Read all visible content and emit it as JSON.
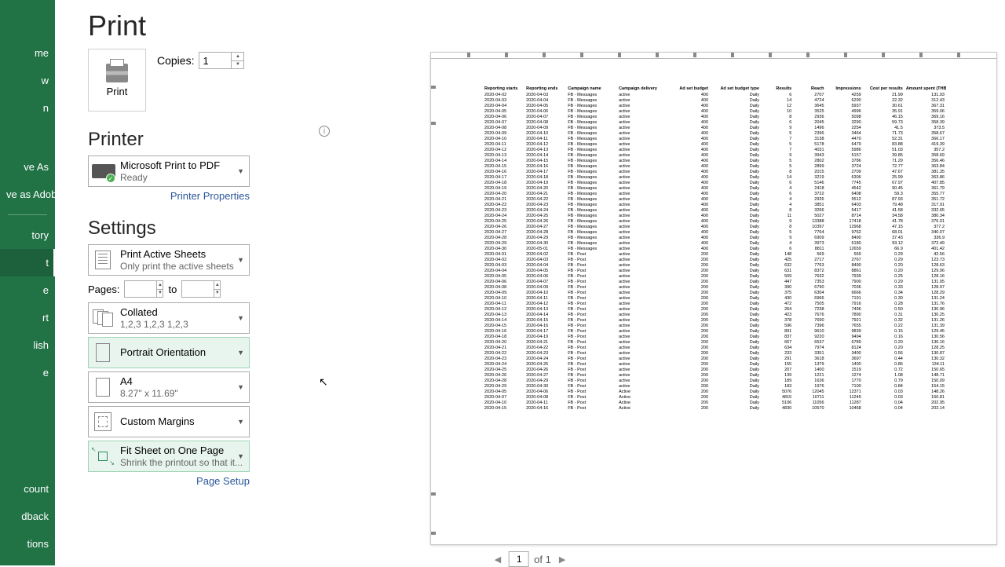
{
  "title": "Print",
  "sidebar": {
    "items": [
      "me",
      "w",
      "n",
      "",
      "",
      "ve As",
      "ve as Adobe F",
      "tory",
      "t",
      "e",
      "rt",
      "lish",
      "e"
    ],
    "bottom": [
      "count",
      "dback",
      "tions"
    ],
    "active_index": 8
  },
  "print_button_label": "Print",
  "copies": {
    "label": "Copies:",
    "value": "1"
  },
  "printer": {
    "heading": "Printer",
    "name": "Microsoft Print to PDF",
    "status": "Ready",
    "properties_link": "Printer Properties"
  },
  "settings": {
    "heading": "Settings",
    "scope": {
      "title": "Print Active Sheets",
      "sub": "Only print the active sheets"
    },
    "pages": {
      "label": "Pages:",
      "to": "to"
    },
    "collate": {
      "title": "Collated",
      "sub": "1,2,3    1,2,3    1,2,3"
    },
    "orientation": {
      "title": "Portrait Orientation"
    },
    "paper": {
      "title": "A4",
      "sub": "8.27\" x 11.69\""
    },
    "margins": {
      "title": "Custom Margins"
    },
    "scaling": {
      "title": "Fit Sheet on One Page",
      "sub": "Shrink the printout so that it..."
    },
    "page_setup_link": "Page Setup"
  },
  "pager": {
    "page": "1",
    "of": "of 1"
  },
  "preview": {
    "headers": [
      "Reporting starts",
      "Reporting ends",
      "Campaign name",
      "Campaign delivery",
      "Ad set budget",
      "Ad set budget type",
      "Results",
      "Reach",
      "Impressions",
      "Cost per results",
      "Amount spent (THB)"
    ],
    "rows": [
      [
        "2020-04-02",
        "2020-04-03",
        "FB - Messages",
        "active",
        "400",
        "Daily",
        "6",
        "2707",
        "4259",
        "21.99",
        "131.93"
      ],
      [
        "2020-04-03",
        "2020-04-04",
        "FB - Messages",
        "active",
        "400",
        "Daily",
        "14",
        "4724",
        "6290",
        "22.32",
        "312.43"
      ],
      [
        "2020-04-04",
        "2020-04-05",
        "FB - Messages",
        "active",
        "400",
        "Daily",
        "12",
        "3645",
        "5937",
        "30.61",
        "367.31"
      ],
      [
        "2020-04-05",
        "2020-04-06",
        "FB - Messages",
        "active",
        "400",
        "Daily",
        "10",
        "3525",
        "4996",
        "35.91",
        "359.06"
      ],
      [
        "2020-04-06",
        "2020-04-07",
        "FB - Messages",
        "active",
        "400",
        "Daily",
        "8",
        "2936",
        "5098",
        "46.15",
        "369.16"
      ],
      [
        "2020-04-07",
        "2020-04-08",
        "FB - Messages",
        "active",
        "400",
        "Daily",
        "6",
        "2045",
        "3290",
        "59.73",
        "358.39"
      ],
      [
        "2020-04-08",
        "2020-04-09",
        "FB - Messages",
        "active",
        "400",
        "Daily",
        "9",
        "1496",
        "2254",
        "41.5",
        "373.5"
      ],
      [
        "2020-04-09",
        "2020-04-10",
        "FB - Messages",
        "active",
        "400",
        "Daily",
        "5",
        "2396",
        "3464",
        "71.73",
        "358.67"
      ],
      [
        "2020-04-10",
        "2020-04-11",
        "FB - Messages",
        "active",
        "400",
        "Daily",
        "7",
        "3138",
        "4470",
        "52.31",
        "366.17"
      ],
      [
        "2020-04-11",
        "2020-04-12",
        "FB - Messages",
        "active",
        "400",
        "Daily",
        "5",
        "5178",
        "6479",
        "83.88",
        "419.39"
      ],
      [
        "2020-04-12",
        "2020-04-13",
        "FB - Messages",
        "active",
        "400",
        "Daily",
        "7",
        "4031",
        "5986",
        "51.03",
        "357.2"
      ],
      [
        "2020-04-13",
        "2020-04-14",
        "FB - Messages",
        "active",
        "400",
        "Daily",
        "9",
        "3943",
        "5157",
        "39.85",
        "358.69"
      ],
      [
        "2020-04-14",
        "2020-04-15",
        "FB - Messages",
        "active",
        "400",
        "Daily",
        "5",
        "2802",
        "3786",
        "71.29",
        "356.46"
      ],
      [
        "2020-04-15",
        "2020-04-16",
        "FB - Messages",
        "active",
        "400",
        "Daily",
        "5",
        "2899",
        "3724",
        "72.77",
        "363.84"
      ],
      [
        "2020-04-16",
        "2020-04-17",
        "FB - Messages",
        "active",
        "400",
        "Daily",
        "8",
        "2015",
        "2709",
        "47.67",
        "381.35"
      ],
      [
        "2020-04-17",
        "2020-04-18",
        "FB - Messages",
        "active",
        "400",
        "Daily",
        "14",
        "3219",
        "6306",
        "25.99",
        "363.86"
      ],
      [
        "2020-04-18",
        "2020-04-19",
        "FB - Messages",
        "active",
        "400",
        "Daily",
        "6",
        "5146",
        "7745",
        "67.97",
        "407.85"
      ],
      [
        "2020-04-19",
        "2020-04-20",
        "FB - Messages",
        "active",
        "400",
        "Daily",
        "4",
        "2418",
        "4542",
        "90.45",
        "361.79"
      ],
      [
        "2020-04-20",
        "2020-04-21",
        "FB - Messages",
        "active",
        "400",
        "Daily",
        "6",
        "3722",
        "6408",
        "59.3",
        "355.77"
      ],
      [
        "2020-04-21",
        "2020-04-22",
        "FB - Messages",
        "active",
        "400",
        "Daily",
        "4",
        "2926",
        "5512",
        "87.93",
        "351.72"
      ],
      [
        "2020-04-22",
        "2020-04-23",
        "FB - Messages",
        "active",
        "400",
        "Daily",
        "4",
        "3851",
        "6403",
        "79.48",
        "317.91"
      ],
      [
        "2020-04-23",
        "2020-04-24",
        "FB - Messages",
        "active",
        "400",
        "Daily",
        "8",
        "3266",
        "5417",
        "41.58",
        "332.65"
      ],
      [
        "2020-04-24",
        "2020-04-25",
        "FB - Messages",
        "active",
        "400",
        "Daily",
        "11",
        "5027",
        "8714",
        "34.58",
        "380.34"
      ],
      [
        "2020-04-25",
        "2020-04-26",
        "FB - Messages",
        "active",
        "400",
        "Daily",
        "9",
        "13388",
        "17418",
        "41.78",
        "376.01"
      ],
      [
        "2020-04-26",
        "2020-04-27",
        "FB - Messages",
        "active",
        "400",
        "Daily",
        "8",
        "10397",
        "12968",
        "47.15",
        "377.2"
      ],
      [
        "2020-04-27",
        "2020-04-28",
        "FB - Messages",
        "active",
        "400",
        "Daily",
        "5",
        "7764",
        "9762",
        "68.01",
        "340.07"
      ],
      [
        "2020-04-28",
        "2020-04-29",
        "FB - Messages",
        "active",
        "400",
        "Daily",
        "9",
        "6909",
        "8490",
        "37.43",
        "336.9"
      ],
      [
        "2020-04-29",
        "2020-04-30",
        "FB - Messages",
        "active",
        "400",
        "Daily",
        "4",
        "3973",
        "5180",
        "93.12",
        "372.49"
      ],
      [
        "2020-04-30",
        "2020-05-01",
        "FB - Messages",
        "active",
        "400",
        "Daily",
        "6",
        "8811",
        "12659",
        "66.9",
        "401.42"
      ],
      [
        "2020-04-01",
        "2020-04-02",
        "FB - Post",
        "active",
        "200",
        "Daily",
        "148",
        "569",
        "569",
        "0.29",
        "42.56"
      ],
      [
        "2020-04-02",
        "2020-04-03",
        "FB - Post",
        "active",
        "200",
        "Daily",
        "425",
        "2717",
        "2767",
        "0.29",
        "123.73"
      ],
      [
        "2020-04-03",
        "2020-04-04",
        "FB - Post",
        "active",
        "200",
        "Daily",
        "632",
        "7763",
        "8490",
        "0.20",
        "128.63"
      ],
      [
        "2020-04-04",
        "2020-04-05",
        "FB - Post",
        "active",
        "200",
        "Daily",
        "631",
        "8372",
        "8861",
        "0.20",
        "129.06"
      ],
      [
        "2020-04-05",
        "2020-04-06",
        "FB - Post",
        "active",
        "200",
        "Daily",
        "509",
        "7632",
        "7939",
        "0.25",
        "128.16"
      ],
      [
        "2020-04-06",
        "2020-04-07",
        "FB - Post",
        "active",
        "200",
        "Daily",
        "447",
        "7353",
        "7900",
        "0.29",
        "131.95"
      ],
      [
        "2020-04-08",
        "2020-04-09",
        "FB - Post",
        "active",
        "200",
        "Daily",
        "390",
        "6790",
        "7036",
        "0.33",
        "128.97"
      ],
      [
        "2020-04-09",
        "2020-04-10",
        "FB - Post",
        "active",
        "200",
        "Daily",
        "375",
        "6304",
        "6666",
        "0.34",
        "128.29"
      ],
      [
        "2020-04-10",
        "2020-04-11",
        "FB - Post",
        "active",
        "200",
        "Daily",
        "430",
        "6966",
        "7191",
        "0.30",
        "131.24"
      ],
      [
        "2020-04-11",
        "2020-04-12",
        "FB - Post",
        "active",
        "200",
        "Daily",
        "472",
        "7505",
        "7916",
        "0.28",
        "131.76"
      ],
      [
        "2020-04-12",
        "2020-04-13",
        "FB - Post",
        "active",
        "200",
        "Daily",
        "264",
        "7238",
        "7496",
        "0.50",
        "130.96"
      ],
      [
        "2020-04-13",
        "2020-04-14",
        "FB - Post",
        "active",
        "200",
        "Daily",
        "423",
        "7676",
        "7890",
        "0.31",
        "130.25"
      ],
      [
        "2020-04-14",
        "2020-04-15",
        "FB - Post",
        "active",
        "200",
        "Daily",
        "378",
        "7690",
        "7921",
        "0.32",
        "131.26"
      ],
      [
        "2020-04-15",
        "2020-04-16",
        "FB - Post",
        "active",
        "200",
        "Daily",
        "596",
        "7396",
        "7655",
        "0.22",
        "131.39"
      ],
      [
        "2020-04-16",
        "2020-04-17",
        "FB - Post",
        "active",
        "200",
        "Daily",
        "891",
        "9610",
        "9839",
        "0.15",
        "129.45"
      ],
      [
        "2020-04-18",
        "2020-04-19",
        "FB - Post",
        "active",
        "200",
        "Daily",
        "837",
        "9220",
        "9494",
        "0.16",
        "130.56"
      ],
      [
        "2020-04-20",
        "2020-04-21",
        "FB - Post",
        "active",
        "200",
        "Daily",
        "667",
        "6537",
        "6789",
        "0.20",
        "130.16"
      ],
      [
        "2020-04-21",
        "2020-04-22",
        "FB - Post",
        "active",
        "200",
        "Daily",
        "634",
        "7974",
        "8124",
        "0.20",
        "128.25"
      ],
      [
        "2020-04-22",
        "2020-04-23",
        "FB - Post",
        "active",
        "200",
        "Daily",
        "233",
        "3351",
        "3400",
        "0.56",
        "130.87"
      ],
      [
        "2020-04-23",
        "2020-04-24",
        "FB - Post",
        "active",
        "200",
        "Daily",
        "291",
        "3618",
        "3697",
        "0.44",
        "130.32"
      ],
      [
        "2020-04-24",
        "2020-04-25",
        "FB - Post",
        "active",
        "200",
        "Daily",
        "155",
        "1379",
        "1400",
        "0.86",
        "134.11"
      ],
      [
        "2020-04-25",
        "2020-04-26",
        "FB - Post",
        "active",
        "200",
        "Daily",
        "207",
        "1400",
        "1519",
        "0.72",
        "150.65"
      ],
      [
        "2020-04-26",
        "2020-04-27",
        "FB - Post",
        "active",
        "200",
        "Daily",
        "139",
        "1221",
        "1274",
        "1.08",
        "148.71"
      ],
      [
        "2020-04-28",
        "2020-04-29",
        "FB - Post",
        "active",
        "200",
        "Daily",
        "189",
        "1636",
        "1770",
        "0.79",
        "150.09"
      ],
      [
        "2020-04-29",
        "2020-04-30",
        "FB - Post",
        "active",
        "200",
        "Daily",
        "183",
        "1976",
        "7100",
        "0.84",
        "154.15"
      ],
      [
        "2020-04-05",
        "2020-04-06",
        "FB - Post",
        "Active",
        "200",
        "Daily",
        "5076",
        "12045",
        "12371",
        "0.03",
        "148.26"
      ],
      [
        "2020-04-07",
        "2020-04-08",
        "FB - Post",
        "Active",
        "200",
        "Daily",
        "4815",
        "10711",
        "11249",
        "0.03",
        "150.81"
      ],
      [
        "2020-04-10",
        "2020-04-11",
        "FB - Post",
        "Active",
        "200",
        "Daily",
        "5106",
        "11056",
        "11287",
        "0.04",
        "202.95"
      ],
      [
        "2020-04-15",
        "2020-04-16",
        "FB - Post",
        "Active",
        "200",
        "Daily",
        "4830",
        "10570",
        "10468",
        "0.04",
        "202.14"
      ]
    ]
  }
}
